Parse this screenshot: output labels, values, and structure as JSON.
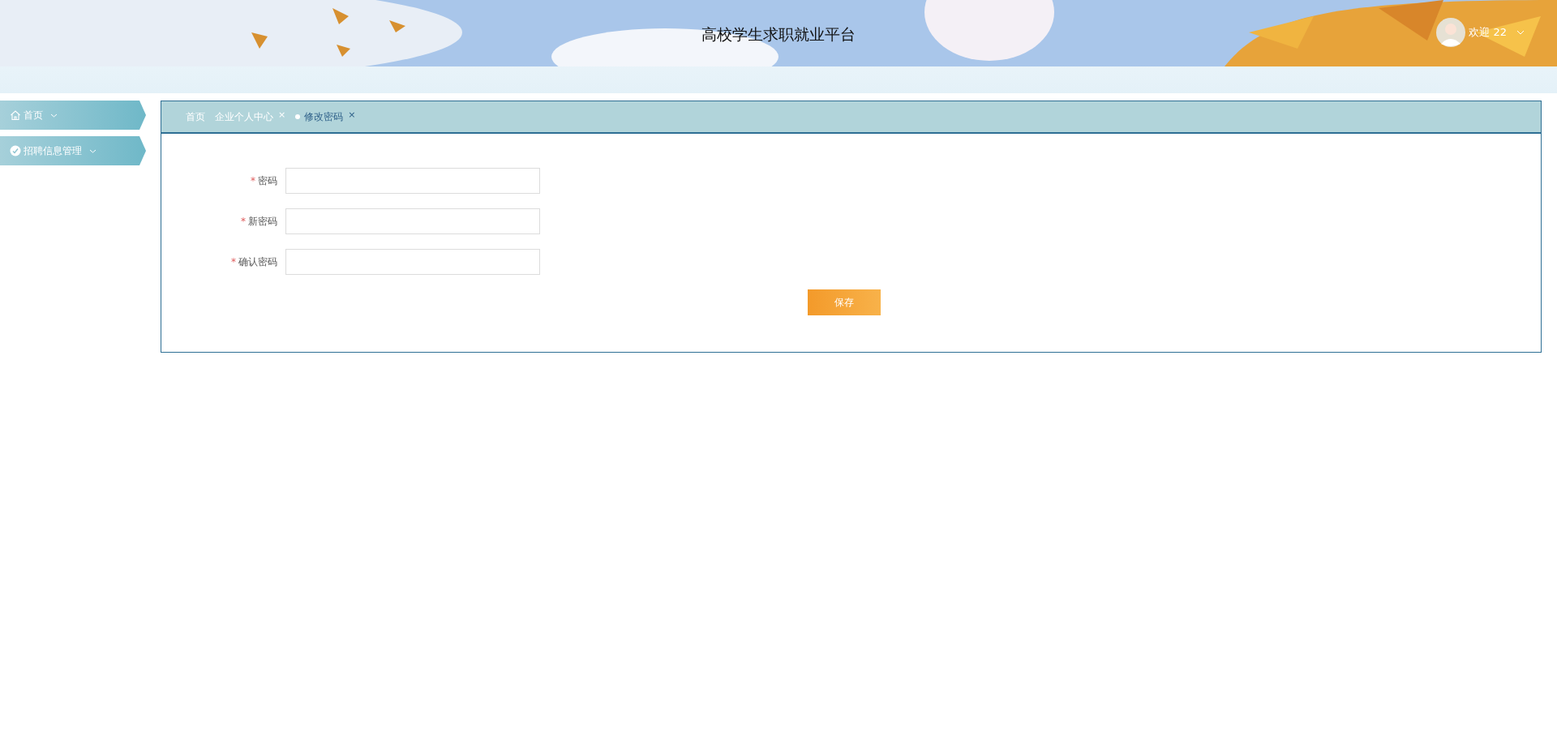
{
  "header": {
    "title": "高校学生求职就业平台",
    "welcome": "欢迎 22"
  },
  "sidebar": {
    "items": [
      {
        "label": "首页",
        "kind": "home"
      },
      {
        "label": "招聘信息管理",
        "kind": "check"
      }
    ]
  },
  "tabs": [
    {
      "label": "首页",
      "selected": false
    },
    {
      "label": "企业个人中心",
      "selected": false,
      "close": "×"
    },
    {
      "label": "修改密码",
      "selected": true,
      "close": "×"
    }
  ],
  "form": {
    "fields": [
      {
        "label": "密码",
        "mark": "*"
      },
      {
        "label": "新密码",
        "mark": "*"
      },
      {
        "label": "确认密码",
        "mark": "*"
      }
    ],
    "save_button": "保存"
  }
}
